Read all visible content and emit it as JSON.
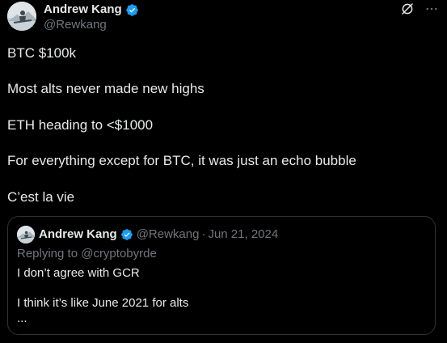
{
  "post": {
    "author": {
      "name": "Andrew Kang",
      "handle": "@Rewkang",
      "verified_color": "#1d9bf0"
    },
    "icons": {
      "grok": "grok-icon",
      "more": "more-icon"
    },
    "body_lines": [
      "BTC $100k",
      "Most alts never made new highs",
      "ETH heading to <$1000",
      "For everything except for BTC, it was just an echo bubble",
      "C’est la vie"
    ]
  },
  "quote": {
    "author_name": "Andrew Kang",
    "handle": "@Rewkang",
    "separator": "·",
    "date": "Jun 21, 2024",
    "replying_to": "Replying to @cryptobyrde",
    "lines": [
      "I don’t agree with GCR",
      "I think it’s like June 2021 for alts",
      "..."
    ]
  },
  "colors": {
    "background": "#000000",
    "text": "#e7e9ea",
    "secondary_text": "#71767b",
    "border": "#2f3336",
    "verified": "#1d9bf0"
  }
}
